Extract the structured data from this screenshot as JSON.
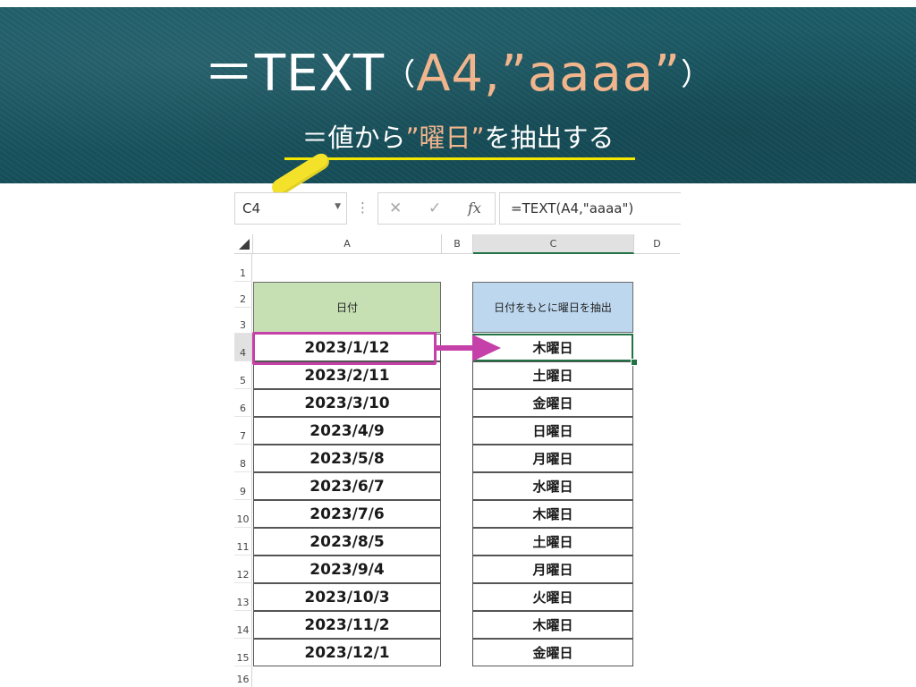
{
  "banner": {
    "formula_prefix": "＝TEXT",
    "formula_open": "（",
    "formula_args": "A4,”aaaa”",
    "formula_close": "）",
    "subtitle_prefix": "＝値から",
    "subtitle_highlight": "”曜日”",
    "subtitle_suffix": "を抽出する",
    "accent_color": "#f1b58d",
    "underline_color": "#f5e800"
  },
  "formula_bar": {
    "name_box": "C4",
    "formula": "=TEXT(A4,\"aaaa\")",
    "cancel_icon": "✕",
    "enter_icon": "✓",
    "fx_label": "fx",
    "menu_icon": "⋮"
  },
  "columns": [
    "A",
    "B",
    "C",
    "D"
  ],
  "rows": [
    "1",
    "2",
    "3",
    "4",
    "5",
    "6",
    "7",
    "8",
    "9",
    "10",
    "11",
    "12",
    "13",
    "14",
    "15",
    "16"
  ],
  "table": {
    "header_a": "日付",
    "header_c": "日付をもとに曜日を抽出",
    "header_a_color": "#c6e0b4",
    "header_c_color": "#bdd7ee",
    "dates": [
      "2023/1/12",
      "2023/2/11",
      "2023/3/10",
      "2023/4/9",
      "2023/5/8",
      "2023/6/7",
      "2023/7/6",
      "2023/8/5",
      "2023/9/4",
      "2023/10/3",
      "2023/11/2",
      "2023/12/1"
    ],
    "weekdays": [
      "木曜日",
      "土曜日",
      "金曜日",
      "日曜日",
      "月曜日",
      "水曜日",
      "木曜日",
      "土曜日",
      "月曜日",
      "火曜日",
      "木曜日",
      "金曜日"
    ]
  },
  "annotation": {
    "highlight_color": "#c540a8",
    "selection_color": "#217346"
  }
}
